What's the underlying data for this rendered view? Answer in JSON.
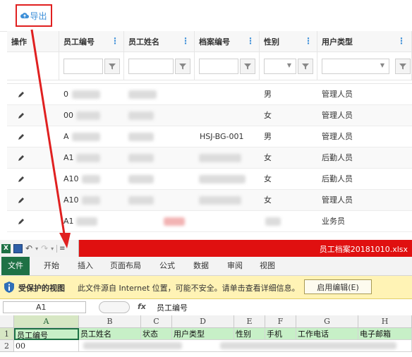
{
  "toolbar": {
    "export_label": "导出"
  },
  "grid": {
    "columns": [
      {
        "label": "操作"
      },
      {
        "label": "员工编号"
      },
      {
        "label": "员工姓名"
      },
      {
        "label": "档案编号"
      },
      {
        "label": "性别"
      },
      {
        "label": "用户类型"
      }
    ],
    "rows": [
      {
        "emp_no": "0",
        "file_no": "",
        "gender": "男",
        "user_type": "管理人员"
      },
      {
        "emp_no": "00",
        "file_no": "",
        "gender": "女",
        "user_type": "管理人员"
      },
      {
        "emp_no": "A",
        "file_no": "HSJ-BG-001",
        "gender": "男",
        "user_type": "管理人员"
      },
      {
        "emp_no": "A1",
        "file_no": "",
        "gender": "女",
        "user_type": "后勤人员"
      },
      {
        "emp_no": "A10",
        "file_no": "",
        "gender": "女",
        "user_type": "后勤人员"
      },
      {
        "emp_no": "A10",
        "file_no": "",
        "gender": "女",
        "user_type": "管理人员"
      },
      {
        "emp_no": "A1",
        "file_no": "",
        "gender": "",
        "user_type": "业务员"
      }
    ]
  },
  "excel": {
    "filename": "员工档案20181010.xlsx",
    "tabs": [
      "文件",
      "开始",
      "插入",
      "页面布局",
      "公式",
      "数据",
      "审阅",
      "视图"
    ],
    "protected_title": "受保护的视图",
    "protected_text": "此文件源自 Internet 位置，可能不安全。请单击查看详细信息。",
    "enable_editing": "启用编辑(E)",
    "name_box": "A1",
    "fx": "fx",
    "formula_value": "员工编号",
    "col_letters": [
      "A",
      "B",
      "C",
      "D",
      "E",
      "F",
      "G",
      "H"
    ],
    "row_numbers": [
      "1",
      "2"
    ],
    "header_row": [
      "员工编号",
      "员工姓名",
      "状态",
      "用户类型",
      "性别",
      "手机",
      "工作电话",
      "电子邮箱"
    ],
    "row2": [
      "00"
    ]
  },
  "colors": {
    "accent": "#3d8fd8",
    "highlight_red": "#e02020",
    "excel_green": "#1e7145",
    "excel_title_red": "#e01010"
  }
}
